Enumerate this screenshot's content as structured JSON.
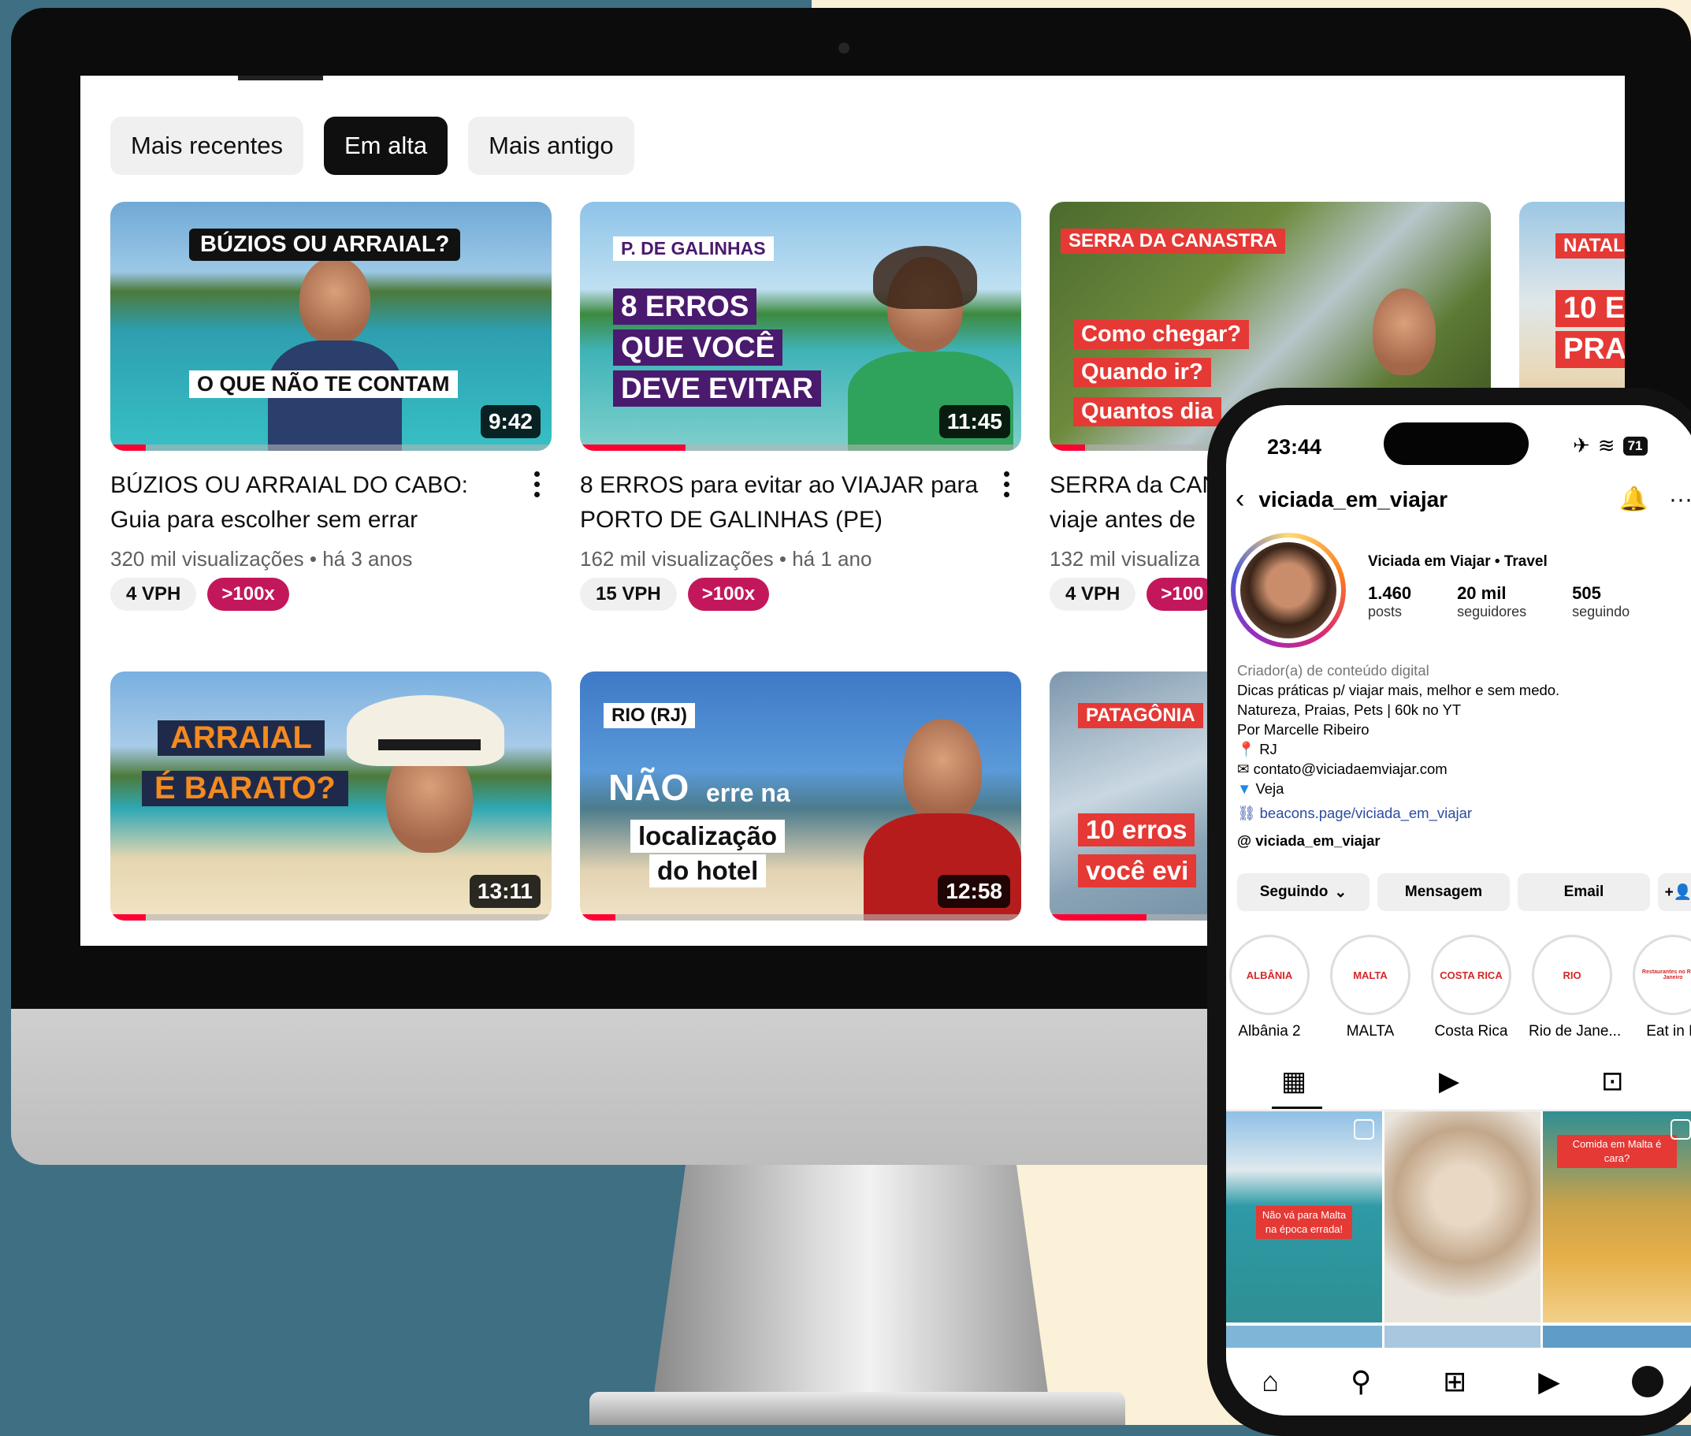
{
  "filters": {
    "recent": "Mais recentes",
    "trending": "Em alta",
    "oldest": "Mais antigo"
  },
  "videos": [
    {
      "title": "BÚZIOS OU ARRAIAL DO CABO: Guia para escolher sem errar",
      "meta": "320 mil visualizações • há 3 anos",
      "vph": "4 VPH",
      "outlier": ">100x",
      "duration": "9:42",
      "overlay_top": "BÚZIOS OU ARRAIAL?",
      "overlay_bottom": "O QUE NÃO TE CONTAM"
    },
    {
      "title": "8 ERROS para evitar ao VIAJAR para PORTO DE GALINHAS (PE)",
      "meta": "162 mil visualizações • há 1 ano",
      "vph": "15 VPH",
      "outlier": ">100x",
      "duration": "11:45",
      "overlay_top": "P. DE GALINHAS",
      "overlay_l1": "8 ERROS",
      "overlay_l2": "QUE VOCÊ",
      "overlay_l3": "DEVE EVITAR"
    },
    {
      "title": "SERRA da CAN",
      "title2": "viaje antes de",
      "meta": "132 mil visualiza",
      "vph": "4 VPH",
      "outlier": ">100",
      "overlay_top": "SERRA DA CANASTRA",
      "overlay_l1": "Como chegar?",
      "overlay_l2": "Quando ir?",
      "overlay_l3": "Quantos dia"
    },
    {
      "overlay_top": "NATAL",
      "overlay_l1": "10 E",
      "overlay_l2": "PRA"
    },
    {
      "duration": "13:11",
      "overlay_l1": "ARRAIAL",
      "overlay_l2": "É BARATO?"
    },
    {
      "duration": "12:58",
      "overlay_top": "RIO (RJ)",
      "overlay_l1": "NÃO",
      "overlay_l1b": "erre na",
      "overlay_l2": "localização",
      "overlay_l3": "do hotel"
    },
    {
      "overlay_top": "PATAGÔNIA",
      "overlay_l1": "10 erros",
      "overlay_l2": "você evi"
    }
  ],
  "phone": {
    "time": "23:44",
    "battery": "71",
    "username": "viciada_em_viajar",
    "display_name": "Viciada em Viajar • Travel",
    "posts": "1.460",
    "posts_label": "posts",
    "followers": "20 mil",
    "followers_label": "seguidores",
    "following": "505",
    "following_label": "seguindo",
    "category": "Criador(a) de conteúdo digital",
    "bio1": "Dicas práticas p/ viajar mais, melhor e sem medo.",
    "bio2": "Natureza, Praias, Pets | 60k no YT",
    "bio3": "Por Marcelle Ribeiro",
    "location": "RJ",
    "email": "contato@viciadaemviajar.com",
    "veja": "Veja",
    "link": "beacons.page/viciada_em_viajar",
    "threads": "viciada_em_viajar",
    "btn_following": "Seguindo",
    "btn_message": "Mensagem",
    "btn_email": "Email",
    "highlights": [
      {
        "label": "Albânia 2",
        "cover": "ALBÂNIA"
      },
      {
        "label": "MALTA",
        "cover": "MALTA"
      },
      {
        "label": "Costa Rica",
        "cover": "COSTA RICA"
      },
      {
        "label": "Rio de Jane...",
        "cover": "RIO"
      },
      {
        "label": "Eat in R",
        "cover": "Restaurantes no Rio de Janeiro"
      }
    ],
    "post1_tag": "Não vá para Malta na época errada!",
    "post3_tag": "Comida em Malta é cara?"
  },
  "colors": {
    "brand_red": "#ff0033",
    "outlier_badge": "#c2185b",
    "background_teal": "#3e6f83",
    "background_cream": "#fbf0d8"
  }
}
